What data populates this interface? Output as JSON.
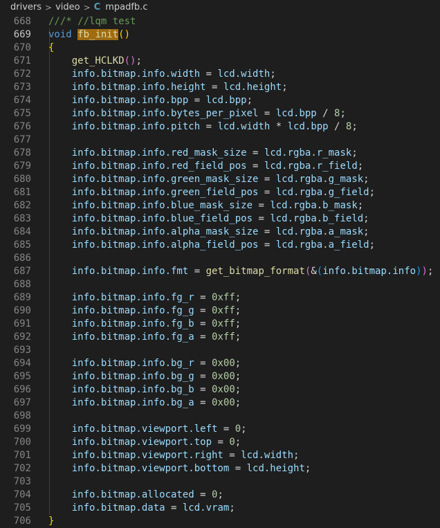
{
  "breadcrumb": {
    "folder1": "drivers",
    "folder2": "video",
    "file_icon": "C",
    "file": "mpadfb.c",
    "separator": ">"
  },
  "icons": {
    "separator": "chevron-right-icon",
    "file": "c-language-icon"
  },
  "colors": {
    "background": "#1e1e1e",
    "keyword": "#569cd6",
    "comment": "#6a9955",
    "function": "#dcdcaa",
    "variable": "#9cdcfe",
    "number": "#b5cea8",
    "highlight": "#a06c10"
  },
  "editor": {
    "active_line": "669",
    "lines": [
      {
        "n": "668",
        "t": [
          [
            "///* //lqm test",
            "cm"
          ]
        ]
      },
      {
        "n": "669",
        "t": [
          [
            "void",
            "k"
          ],
          [
            " ",
            ""
          ],
          [
            "fb_init",
            "fnhl"
          ],
          [
            "()",
            "b1"
          ]
        ]
      },
      {
        "n": "670",
        "t": [
          [
            "{",
            "b1"
          ]
        ]
      },
      {
        "n": "671",
        "t": [
          [
            "    ",
            ""
          ],
          [
            "get_HCLKD",
            "fn"
          ],
          [
            "()",
            "b2"
          ],
          [
            ";",
            ""
          ]
        ]
      },
      {
        "n": "672",
        "t": [
          [
            "    ",
            ""
          ],
          [
            "info.bitmap.info.width",
            "v"
          ],
          [
            " = ",
            ""
          ],
          [
            "lcd.width",
            "v"
          ],
          [
            ";",
            ""
          ]
        ]
      },
      {
        "n": "673",
        "t": [
          [
            "    ",
            ""
          ],
          [
            "info.bitmap.info.height",
            "v"
          ],
          [
            " = ",
            ""
          ],
          [
            "lcd.height",
            "v"
          ],
          [
            ";",
            ""
          ]
        ]
      },
      {
        "n": "674",
        "t": [
          [
            "    ",
            ""
          ],
          [
            "info.bitmap.info.bpp",
            "v"
          ],
          [
            " = ",
            ""
          ],
          [
            "lcd.bpp",
            "v"
          ],
          [
            ";",
            ""
          ]
        ]
      },
      {
        "n": "675",
        "t": [
          [
            "    ",
            ""
          ],
          [
            "info.bitmap.info.bytes_per_pixel",
            "v"
          ],
          [
            " = ",
            ""
          ],
          [
            "lcd.bpp",
            "v"
          ],
          [
            " / ",
            ""
          ],
          [
            "8",
            "n"
          ],
          [
            ";",
            ""
          ]
        ]
      },
      {
        "n": "676",
        "t": [
          [
            "    ",
            ""
          ],
          [
            "info.bitmap.info.pitch",
            "v"
          ],
          [
            " = ",
            ""
          ],
          [
            "lcd.width",
            "v"
          ],
          [
            " * ",
            ""
          ],
          [
            "lcd.bpp",
            "v"
          ],
          [
            " / ",
            ""
          ],
          [
            "8",
            "n"
          ],
          [
            ";",
            ""
          ]
        ]
      },
      {
        "n": "677",
        "t": []
      },
      {
        "n": "678",
        "t": [
          [
            "    ",
            ""
          ],
          [
            "info.bitmap.info.red_mask_size",
            "v"
          ],
          [
            " = ",
            ""
          ],
          [
            "lcd.rgba.r_mask",
            "v"
          ],
          [
            ";",
            ""
          ]
        ]
      },
      {
        "n": "679",
        "t": [
          [
            "    ",
            ""
          ],
          [
            "info.bitmap.info.red_field_pos",
            "v"
          ],
          [
            " = ",
            ""
          ],
          [
            "lcd.rgba.r_field",
            "v"
          ],
          [
            ";",
            ""
          ]
        ]
      },
      {
        "n": "680",
        "t": [
          [
            "    ",
            ""
          ],
          [
            "info.bitmap.info.green_mask_size",
            "v"
          ],
          [
            " = ",
            ""
          ],
          [
            "lcd.rgba.g_mask",
            "v"
          ],
          [
            ";",
            ""
          ]
        ]
      },
      {
        "n": "681",
        "t": [
          [
            "    ",
            ""
          ],
          [
            "info.bitmap.info.green_field_pos",
            "v"
          ],
          [
            " = ",
            ""
          ],
          [
            "lcd.rgba.g_field",
            "v"
          ],
          [
            ";",
            ""
          ]
        ]
      },
      {
        "n": "682",
        "t": [
          [
            "    ",
            ""
          ],
          [
            "info.bitmap.info.blue_mask_size",
            "v"
          ],
          [
            " = ",
            ""
          ],
          [
            "lcd.rgba.b_mask",
            "v"
          ],
          [
            ";",
            ""
          ]
        ]
      },
      {
        "n": "683",
        "t": [
          [
            "    ",
            ""
          ],
          [
            "info.bitmap.info.blue_field_pos",
            "v"
          ],
          [
            " = ",
            ""
          ],
          [
            "lcd.rgba.b_field",
            "v"
          ],
          [
            ";",
            ""
          ]
        ]
      },
      {
        "n": "684",
        "t": [
          [
            "    ",
            ""
          ],
          [
            "info.bitmap.info.alpha_mask_size",
            "v"
          ],
          [
            " = ",
            ""
          ],
          [
            "lcd.rgba.a_mask",
            "v"
          ],
          [
            ";",
            ""
          ]
        ]
      },
      {
        "n": "685",
        "t": [
          [
            "    ",
            ""
          ],
          [
            "info.bitmap.info.alpha_field_pos",
            "v"
          ],
          [
            " = ",
            ""
          ],
          [
            "lcd.rgba.a_field",
            "v"
          ],
          [
            ";",
            ""
          ]
        ]
      },
      {
        "n": "686",
        "t": []
      },
      {
        "n": "687",
        "t": [
          [
            "    ",
            ""
          ],
          [
            "info.bitmap.info.fmt",
            "v"
          ],
          [
            " = ",
            ""
          ],
          [
            "get_bitmap_format",
            "fn"
          ],
          [
            "(",
            "b2"
          ],
          [
            "&",
            "op"
          ],
          [
            "(",
            "b3"
          ],
          [
            "info.bitmap.info",
            "v"
          ],
          [
            ")",
            "b3"
          ],
          [
            ")",
            "b2"
          ],
          [
            ";",
            ""
          ]
        ]
      },
      {
        "n": "688",
        "t": []
      },
      {
        "n": "689",
        "t": [
          [
            "    ",
            ""
          ],
          [
            "info.bitmap.info.fg_r",
            "v"
          ],
          [
            " = ",
            ""
          ],
          [
            "0xff",
            "n"
          ],
          [
            ";",
            ""
          ]
        ]
      },
      {
        "n": "690",
        "t": [
          [
            "    ",
            ""
          ],
          [
            "info.bitmap.info.fg_g",
            "v"
          ],
          [
            " = ",
            ""
          ],
          [
            "0xff",
            "n"
          ],
          [
            ";",
            ""
          ]
        ]
      },
      {
        "n": "691",
        "t": [
          [
            "    ",
            ""
          ],
          [
            "info.bitmap.info.fg_b",
            "v"
          ],
          [
            " = ",
            ""
          ],
          [
            "0xff",
            "n"
          ],
          [
            ";",
            ""
          ]
        ]
      },
      {
        "n": "692",
        "t": [
          [
            "    ",
            ""
          ],
          [
            "info.bitmap.info.fg_a",
            "v"
          ],
          [
            " = ",
            ""
          ],
          [
            "0xff",
            "n"
          ],
          [
            ";",
            ""
          ]
        ]
      },
      {
        "n": "693",
        "t": []
      },
      {
        "n": "694",
        "t": [
          [
            "    ",
            ""
          ],
          [
            "info.bitmap.info.bg_r",
            "v"
          ],
          [
            " = ",
            ""
          ],
          [
            "0x00",
            "n"
          ],
          [
            ";",
            ""
          ]
        ]
      },
      {
        "n": "695",
        "t": [
          [
            "    ",
            ""
          ],
          [
            "info.bitmap.info.bg_g",
            "v"
          ],
          [
            " = ",
            ""
          ],
          [
            "0x00",
            "n"
          ],
          [
            ";",
            ""
          ]
        ]
      },
      {
        "n": "696",
        "t": [
          [
            "    ",
            ""
          ],
          [
            "info.bitmap.info.bg_b",
            "v"
          ],
          [
            " = ",
            ""
          ],
          [
            "0x00",
            "n"
          ],
          [
            ";",
            ""
          ]
        ]
      },
      {
        "n": "697",
        "t": [
          [
            "    ",
            ""
          ],
          [
            "info.bitmap.info.bg_a",
            "v"
          ],
          [
            " = ",
            ""
          ],
          [
            "0x00",
            "n"
          ],
          [
            ";",
            ""
          ]
        ]
      },
      {
        "n": "698",
        "t": []
      },
      {
        "n": "699",
        "t": [
          [
            "    ",
            ""
          ],
          [
            "info.bitmap.viewport.left",
            "v"
          ],
          [
            " = ",
            ""
          ],
          [
            "0",
            "n"
          ],
          [
            ";",
            ""
          ]
        ]
      },
      {
        "n": "700",
        "t": [
          [
            "    ",
            ""
          ],
          [
            "info.bitmap.viewport.top",
            "v"
          ],
          [
            " = ",
            ""
          ],
          [
            "0",
            "n"
          ],
          [
            ";",
            ""
          ]
        ]
      },
      {
        "n": "701",
        "t": [
          [
            "    ",
            ""
          ],
          [
            "info.bitmap.viewport.right",
            "v"
          ],
          [
            " = ",
            ""
          ],
          [
            "lcd.width",
            "v"
          ],
          [
            ";",
            ""
          ]
        ]
      },
      {
        "n": "702",
        "t": [
          [
            "    ",
            ""
          ],
          [
            "info.bitmap.viewport.bottom",
            "v"
          ],
          [
            " = ",
            ""
          ],
          [
            "lcd.height",
            "v"
          ],
          [
            ";",
            ""
          ]
        ]
      },
      {
        "n": "703",
        "t": []
      },
      {
        "n": "704",
        "t": [
          [
            "    ",
            ""
          ],
          [
            "info.bitmap.allocated",
            "v"
          ],
          [
            " = ",
            ""
          ],
          [
            "0",
            "n"
          ],
          [
            ";",
            ""
          ]
        ]
      },
      {
        "n": "705",
        "t": [
          [
            "    ",
            ""
          ],
          [
            "info.bitmap.data",
            "v"
          ],
          [
            " = ",
            ""
          ],
          [
            "lcd.vram",
            "v"
          ],
          [
            ";",
            ""
          ]
        ]
      },
      {
        "n": "706",
        "t": [
          [
            "}",
            "b1"
          ]
        ]
      }
    ]
  }
}
